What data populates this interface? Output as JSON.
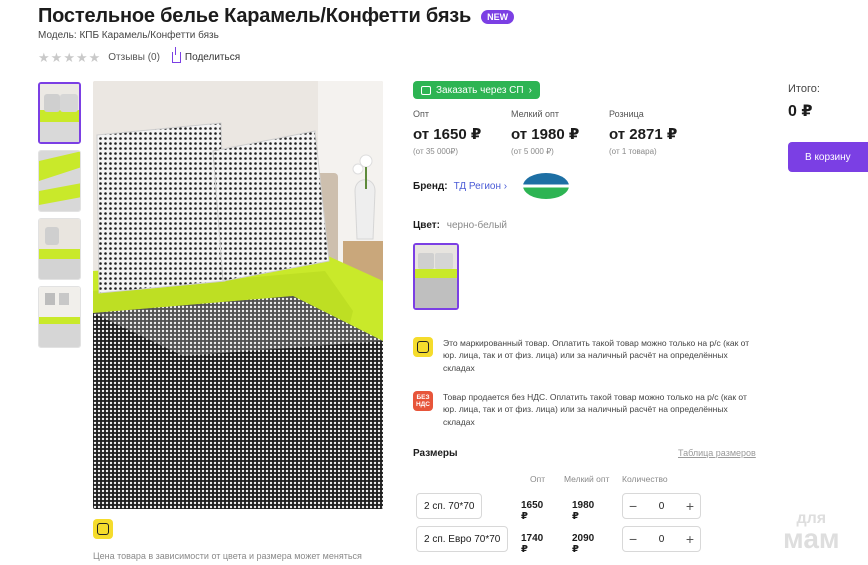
{
  "product": {
    "title": "Постельное белье Карамель/Конфетти бязь",
    "badge": "NEW",
    "model": "Модель: КПБ Карамель/Конфетти бязь",
    "reviews": "Отзывы (0)",
    "share": "Поделиться",
    "rating_stars": 0
  },
  "order_sp": "Заказать через СП",
  "prices": [
    {
      "label": "Опт",
      "value": "от 1650 ₽",
      "sub": "(от 35 000₽)"
    },
    {
      "label": "Мелкий опт",
      "value": "от 1980 ₽",
      "sub": "(от 5 000 ₽)"
    },
    {
      "label": "Розница",
      "value": "от 2871 ₽",
      "sub": "(от 1 товара)"
    }
  ],
  "brand": {
    "label": "Бренд:",
    "name": "ТД Регион"
  },
  "color": {
    "label": "Цвет:",
    "value": "черно-белый"
  },
  "notices": [
    {
      "icon": "marking-icon",
      "text": "Это маркированный товар. Оплатить такой товар можно только на р/с (как от юр. лица, так и от физ. лица) или за наличный расчёт на определённых складах"
    },
    {
      "icon": "no-vat-icon",
      "icon_text": "БЕЗ НДС",
      "text": "Товар продается без НДС. Оплатить такой товар можно только на р/с (как от юр. лица, так и от физ. лица) или за наличный расчёт на определённых складах"
    }
  ],
  "sizes": {
    "title": "Размеры",
    "table_link": "Таблица размеров",
    "headers": {
      "opt": "Опт",
      "small": "Мелкий опт",
      "qty": "Количество"
    },
    "rows": [
      {
        "name": "2 сп. 70*70",
        "opt": "1650 ₽",
        "small": "1980 ₽",
        "qty": "0"
      },
      {
        "name": "2 сп. Евро 70*70",
        "opt": "1740 ₽",
        "small": "2090 ₽",
        "qty": "0"
      }
    ]
  },
  "total": {
    "label": "Итого:",
    "value": "0 ₽"
  },
  "cart_button": "В корзину",
  "price_note": "Цена товара в зависимости от цвета и размера может меняться",
  "watermark": {
    "line1": "для",
    "line2": "мам"
  },
  "colors": {
    "accent": "#7b3fe4",
    "green": "#2db453",
    "marking": "#f5dc2c",
    "nds": "#e7553a",
    "lime": "#c9e92a"
  }
}
